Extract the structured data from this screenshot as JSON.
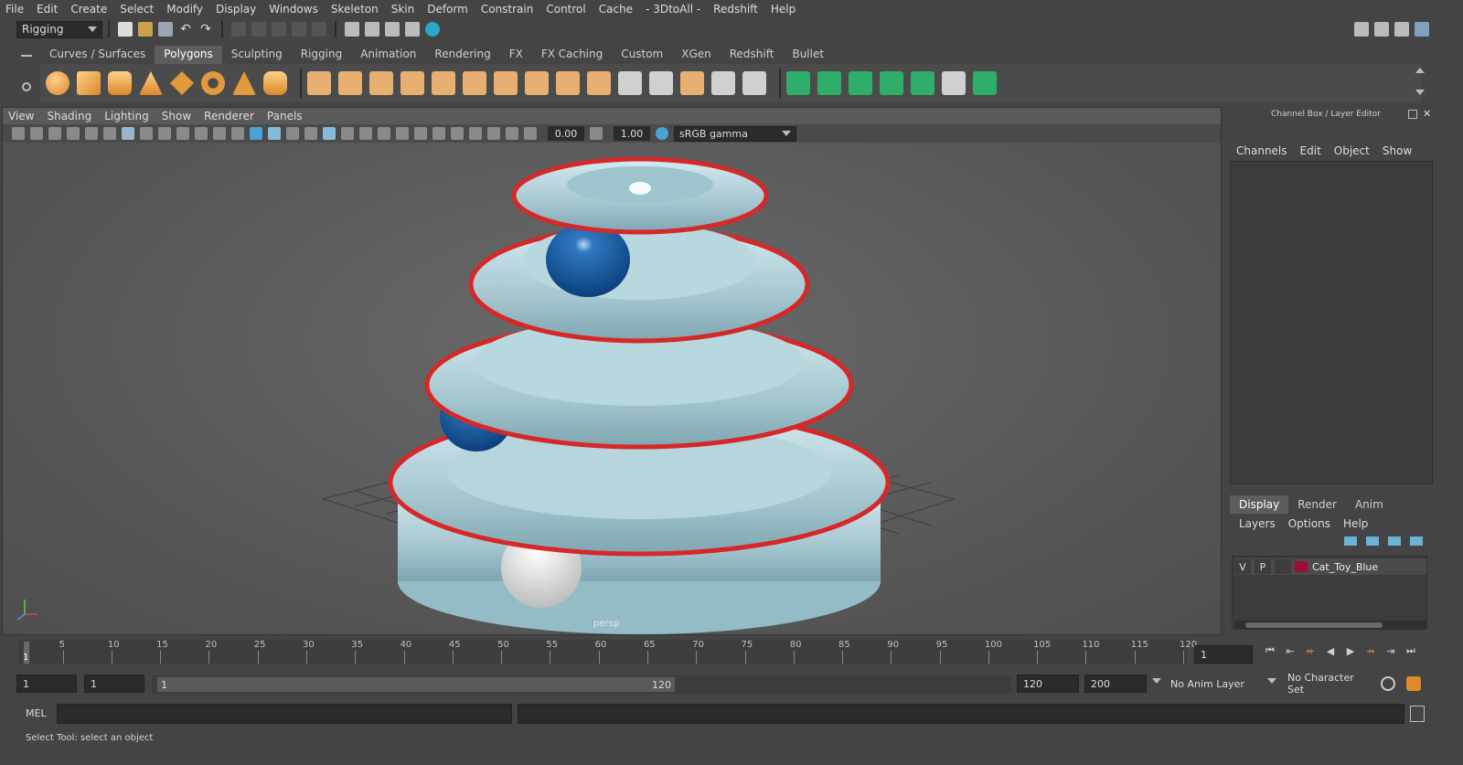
{
  "menubar": [
    "File",
    "Edit",
    "Create",
    "Select",
    "Modify",
    "Display",
    "Windows",
    "Skeleton",
    "Skin",
    "Deform",
    "Constrain",
    "Control",
    "Cache",
    "- 3DtoAll -",
    "Redshift",
    "Help"
  ],
  "status": {
    "menuset": "Rigging"
  },
  "shelf": {
    "tabs": [
      "Curves / Surfaces",
      "Polygons",
      "Sculpting",
      "Rigging",
      "Animation",
      "Rendering",
      "FX",
      "FX Caching",
      "Custom",
      "XGen",
      "Redshift",
      "Bullet"
    ],
    "active_tab": "Polygons"
  },
  "viewport": {
    "menus": [
      "View",
      "Shading",
      "Lighting",
      "Show",
      "Renderer",
      "Panels"
    ],
    "exposure": "0.00",
    "gamma": "1.00",
    "colorspace": "sRGB gamma",
    "camera_label": "persp"
  },
  "channelbox": {
    "title": "Channel Box / Layer Editor",
    "menus": [
      "Channels",
      "Edit",
      "Object",
      "Show"
    ]
  },
  "layer_editor": {
    "tabs": [
      "Display",
      "Render",
      "Anim"
    ],
    "active_tab": "Display",
    "menus": [
      "Layers",
      "Options",
      "Help"
    ],
    "layers": [
      {
        "v": "V",
        "p": "P",
        "name": "Cat_Toy_Blue",
        "color": "#9b1030"
      }
    ]
  },
  "timeline": {
    "ticks": [
      "5",
      "10",
      "15",
      "20",
      "25",
      "30",
      "35",
      "40",
      "45",
      "50",
      "55",
      "60",
      "65",
      "70",
      "75",
      "80",
      "85",
      "90",
      "95",
      "100",
      "105",
      "110",
      "115",
      "120"
    ],
    "current_frame_label": "1",
    "current_frame_field": "1"
  },
  "range": {
    "start": "1",
    "playback_start": "1",
    "slider_start": "1",
    "slider_end": "120",
    "playback_end": "120",
    "end": "200",
    "anim_layer": "No Anim Layer",
    "character_set": "No Character Set"
  },
  "command": {
    "label": "MEL"
  },
  "help": {
    "text": "Select Tool: select an object"
  }
}
